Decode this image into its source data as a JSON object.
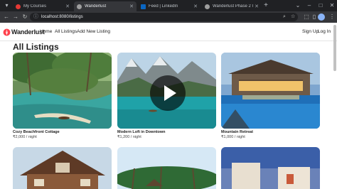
{
  "browser": {
    "tabs": [
      {
        "title": "My Courses",
        "color": "#e53935",
        "active": false
      },
      {
        "title": "Wanderlust",
        "color": "#9e9e9e",
        "active": true
      },
      {
        "title": "Feed | LinkedIn",
        "color": "#0a66c2",
        "active": false
      },
      {
        "title": "Wanderlust Phase 2 Update",
        "color": "#9e9e9e",
        "active": false
      }
    ],
    "new_tab": "+",
    "window_controls": [
      "⌄",
      "–",
      "□",
      "✕"
    ],
    "url": "localhost:8080/listings"
  },
  "navbar": {
    "brand": "Wanderlust",
    "brand_color": "#fe424d",
    "links": [
      "Home",
      "All Listings",
      "Add New Listing"
    ],
    "right_links": [
      "Sign Up",
      "Log In"
    ]
  },
  "page": {
    "heading": "All Listings",
    "currency_suffix": " / night",
    "listings": [
      {
        "name": "Cozy Beachfront Cottage",
        "price": "₹2,000"
      },
      {
        "name": "Modern Loft in Downtown",
        "price": "₹1,200"
      },
      {
        "name": "Mountain Retreat",
        "price": "₹1,000"
      }
    ]
  },
  "video_overlay": {
    "icon": "play-icon"
  }
}
